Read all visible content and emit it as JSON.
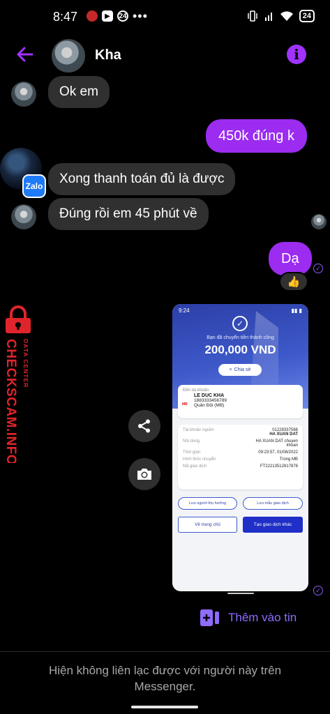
{
  "status_bar": {
    "time": "8:47",
    "notif_count": "24",
    "battery": "24"
  },
  "header": {
    "contact_name": "Kha",
    "info_icon": "i"
  },
  "messages": [
    {
      "dir": "in",
      "text": "Ok em"
    },
    {
      "dir": "out",
      "text": "450k đúng k"
    },
    {
      "dir": "in",
      "text": "Xong thanh toán đủ là được"
    },
    {
      "dir": "in",
      "text": "Đúng rồi em 45 phút về"
    },
    {
      "dir": "out",
      "text": "Dạ",
      "reaction": "👍"
    }
  ],
  "overlay_badge": "Zalo",
  "watermark": {
    "main": "CHECKSCAM.INFO",
    "sub": "DATA CENTER"
  },
  "shared_image": {
    "status_time": "9:24",
    "done_text": "Bạn đã chuyển tiền thành công",
    "amount": "200,000 VND",
    "share_label": "Chia sẻ",
    "to_account_label": "Đến tài khoản",
    "recipient_name": "LE DUC KHA",
    "recipient_account": "1883333456789",
    "recipient_bank": "Quân Đội (MB)",
    "bank_logo": "MB",
    "details": [
      {
        "k": "Tài khoản nguồn",
        "v": "01228337566",
        "v2": "HA XUAN DAT"
      },
      {
        "k": "Nội dung",
        "v": "HA XUAN DAT chuyen",
        "v2": "khoan"
      },
      {
        "k": "Thời gian",
        "v": "09:23:57, 01/08/2022",
        "v2": ""
      },
      {
        "k": "Hình thức chuyển",
        "v": "Trong MB",
        "v2": ""
      },
      {
        "k": "Mã giao dịch",
        "v": "FT22213512817876",
        "v2": ""
      }
    ],
    "save_payee": "Lưu người thụ hưởng",
    "save_template": "Lưu mẫu giao dịch",
    "home_btn": "Về trang chủ",
    "new_txn_btn": "Tạo giao dịch khác"
  },
  "add_to_story": "Thêm vào tin",
  "footer_notice": "Hiện không liên lạc được với người này trên Messenger.",
  "colors": {
    "accent": "#9b2cf0",
    "bubble_in": "#303030",
    "watermark_red": "#e0242b"
  }
}
